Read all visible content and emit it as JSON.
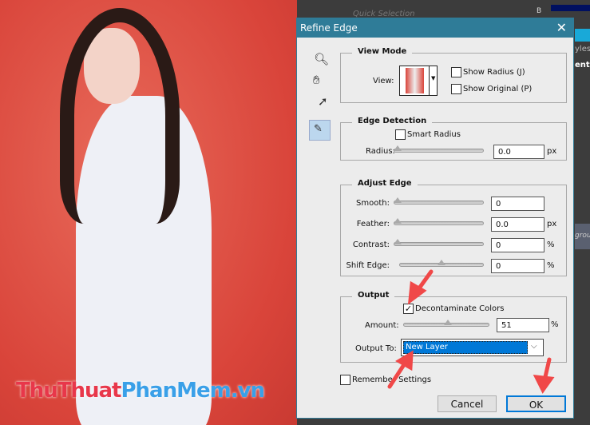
{
  "background": {
    "watermark": {
      "part1": "ThuThuat",
      "part2": "PhanMem.vn",
      "color1": "#e8374a",
      "color2": "#3aa0e8"
    },
    "ps_panel": {
      "quick_selection": "Quick Selection",
      "channel_b": "B",
      "styles_tab": "yles",
      "adjust_tab": "ent",
      "layer_name": "grou"
    }
  },
  "dialog": {
    "title": "Refine Edge",
    "close_icon": "close-icon",
    "tools": [
      "zoom-icon",
      "hand-icon",
      "pointer-icon",
      "refine-brush-icon"
    ],
    "view_mode": {
      "legend": "View Mode",
      "view_label": "View:",
      "show_radius": "Show Radius (J)",
      "show_original": "Show Original (P)",
      "show_radius_checked": false,
      "show_original_checked": false
    },
    "edge_detection": {
      "legend": "Edge Detection",
      "smart_radius": "Smart Radius",
      "smart_radius_checked": false,
      "radius_label": "Radius:",
      "radius_value": "0.0",
      "radius_unit": "px",
      "radius_slider": 0
    },
    "adjust_edge": {
      "legend": "Adjust Edge",
      "rows": [
        {
          "label": "Smooth:",
          "value": "0",
          "unit": "",
          "slider": 0
        },
        {
          "label": "Feather:",
          "value": "0.0",
          "unit": "px",
          "slider": 0
        },
        {
          "label": "Contrast:",
          "value": "0",
          "unit": "%",
          "slider": 0
        },
        {
          "label": "Shift Edge:",
          "value": "0",
          "unit": "%",
          "slider": 0.5
        }
      ]
    },
    "output": {
      "legend": "Output",
      "decontaminate": "Decontaminate Colors",
      "decontaminate_checked": true,
      "amount_label": "Amount:",
      "amount_value": "51",
      "amount_unit": "%",
      "amount_slider": 0.51,
      "output_to_label": "Output To:",
      "output_to_value": "New Layer"
    },
    "remember_settings": "Remember Settings",
    "remember_checked": false,
    "cancel": "Cancel",
    "ok": "OK",
    "accent": "#2f7c98",
    "arrow_color": "#f04848"
  }
}
